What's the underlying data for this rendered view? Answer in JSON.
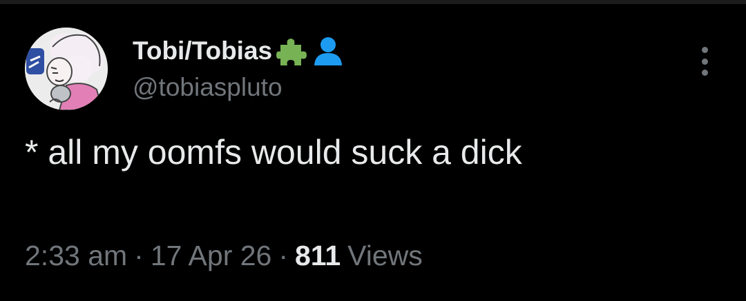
{
  "tweet": {
    "author": {
      "display_name": "Tobi/Tobias",
      "badges": [
        "puzzle-piece-icon",
        "person-silhouette-icon"
      ],
      "handle": "@tobiaspluto",
      "avatar": "illustrated-character-avatar"
    },
    "text": "* all my oomfs would suck a dick",
    "time": "2:33 am",
    "date": "17 Apr 26",
    "separator": "·",
    "views_count": "811",
    "views_label": "Views",
    "more_icon": "vertical-ellipsis-icon"
  },
  "colors": {
    "background": "#000000",
    "primary_text": "#e7e9ea",
    "secondary_text": "#71767b",
    "puzzle_green": "#77b255",
    "person_blue": "#1d9bf0"
  }
}
